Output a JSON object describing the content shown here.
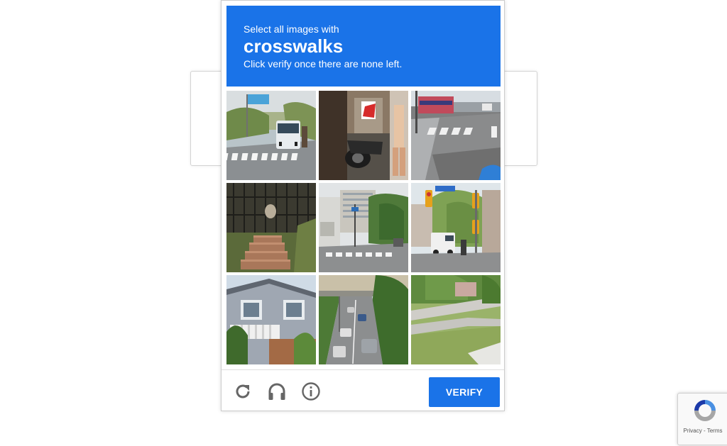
{
  "challenge": {
    "instruction": "Select all images with",
    "keyword": "crosswalks",
    "subinstruction": "Click verify once there are none left.",
    "header_color": "#1a73e8",
    "tiles": [
      {
        "label": "street with bus and crosswalk",
        "icon": "tile-image"
      },
      {
        "label": "person with motorcycle in doorway",
        "icon": "tile-image"
      },
      {
        "label": "intersection crosswalk",
        "icon": "tile-image"
      },
      {
        "label": "steps in front of fence",
        "icon": "tile-image"
      },
      {
        "label": "street with crosswalk and buildings",
        "icon": "tile-image"
      },
      {
        "label": "traffic lights and van",
        "icon": "tile-image"
      },
      {
        "label": "suburban house",
        "icon": "tile-image"
      },
      {
        "label": "highway with cars",
        "icon": "tile-image"
      },
      {
        "label": "park path and grass",
        "icon": "tile-image"
      }
    ]
  },
  "footer": {
    "reload_icon": "reload-icon",
    "audio_icon": "headphones-icon",
    "info_icon": "info-icon",
    "verify_label": "VERIFY"
  },
  "badge": {
    "links": "Privacy - Terms",
    "logo_icon": "recaptcha-logo-icon"
  }
}
